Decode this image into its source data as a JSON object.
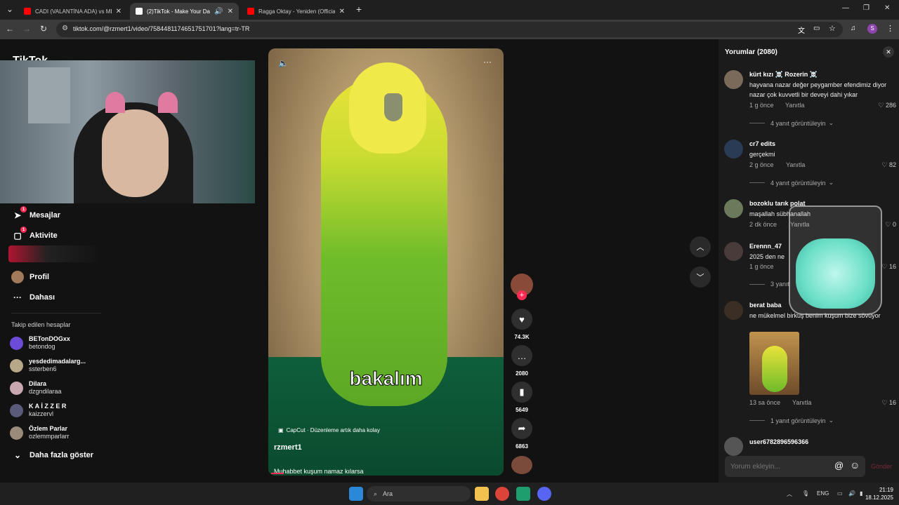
{
  "browser": {
    "tabs": [
      {
        "title": "CADI (VALANTİNA ADA) vs MEL",
        "favicon_color": "#ff0000"
      },
      {
        "title": "(2)TikTok - Make Your Day",
        "favicon_color": "#000000"
      },
      {
        "title": "Ragga Oktay - Yeniden (Official",
        "favicon_color": "#ff0000"
      }
    ],
    "url": "tiktok.com/@rzmert1/video/7584481174651751701?lang=tr-TR"
  },
  "tiktok": {
    "logo": "TikTok",
    "nav": [
      {
        "label": "Mesajlar",
        "icon": "send-icon",
        "badge": "1"
      },
      {
        "label": "Aktivite",
        "icon": "message-square-icon",
        "badge": "1"
      },
      {
        "label": "Profil",
        "icon": "avatar-icon"
      },
      {
        "label": "Dahası",
        "icon": "more-icon"
      }
    ],
    "following_heading": "Takip edilen hesaplar",
    "following": [
      {
        "name": "BETonDOGxx",
        "handle": "betondog"
      },
      {
        "name": "yesdedimadalarg...",
        "handle": "ssterben6"
      },
      {
        "name": "Dilara",
        "handle": "dzgndilaraa"
      },
      {
        "name": "K A İ Z Z E R",
        "handle": "kaizzervl"
      },
      {
        "name": "Özlem Parlar",
        "handle": "ozlemmparlarr"
      }
    ],
    "show_more": "Daha fazla göster"
  },
  "video": {
    "overlay_text": "bakalım",
    "capcut": "CapCut · Düzenleme artık daha kolay",
    "author": "rzmert1",
    "description": "Muhabbet kuşum namaz kılarsa",
    "likes": "74.3K",
    "comments": "2080",
    "saves": "5649",
    "shares": "6863"
  },
  "comments": {
    "title": "Yorumlar (2080)",
    "reply_label": "Yanıtla",
    "items": [
      {
        "name": "kürt kızı ☠️ Rozerin ☠️",
        "text": "hayvana nazar değer peygamber efendimiz diyor nazar çok kuvvetli bir deveyi dahi yıkar",
        "time": "1 g önce",
        "likes": "286",
        "more": "4 yanıt görüntüleyin",
        "avatar_color": "#7a6a5a"
      },
      {
        "name": "cr7 edits",
        "text": "gerçekmi",
        "time": "2 g önce",
        "likes": "82",
        "more": "4 yanıt görüntüleyin",
        "avatar_color": "#2a3b55"
      },
      {
        "name": "bozoklu tarık polat",
        "text": "maşallah sübhanallah",
        "time": "2 dk önce",
        "likes": "0",
        "avatar_color": "#6b7a5a"
      },
      {
        "name": "Erennn_47",
        "text": "2025 den ne",
        "time": "1 g önce",
        "likes": "16",
        "more": "3 yanıt",
        "avatar_color": "#4a3b3b"
      },
      {
        "name": "berat baba",
        "text": "ne mükelmel birkuş benim kuşum bize sövüyor",
        "time": "13 sa önce",
        "likes": "16",
        "more": "1 yanıt görüntüleyin",
        "avatar_color": "#3b2e24"
      },
      {
        "name": "user6782896596366",
        "avatar_color": "#555555"
      }
    ],
    "input_placeholder": "Yorum ekleyin...",
    "send": "Gönder"
  },
  "taskbar": {
    "search": "Ara",
    "lang": "ENG",
    "time": "21:19",
    "date": "18.12.2025"
  }
}
